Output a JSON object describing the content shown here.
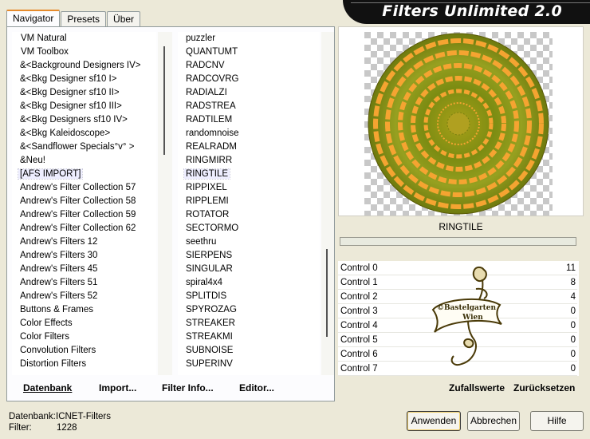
{
  "banner": {
    "title": "Filters Unlimited 2.0"
  },
  "tabs": [
    {
      "label": "Navigator",
      "active": true
    },
    {
      "label": "Presets",
      "active": false
    },
    {
      "label": "Über",
      "active": false
    }
  ],
  "categories": [
    "VM Natural",
    "VM Toolbox",
    "&<Background Designers IV>",
    "&<Bkg Designer sf10 I>",
    "&<Bkg Designer sf10 II>",
    "&<Bkg Designer sf10 III>",
    "&<Bkg Designers sf10 IV>",
    "&<Bkg Kaleidoscope>",
    "&<Sandflower Specials°v° >",
    "&Neu!",
    "[AFS IMPORT]",
    "Andrew's Filter Collection 57",
    "Andrew's Filter Collection 58",
    "Andrew's Filter Collection 59",
    "Andrew's Filter Collection 62",
    "Andrew's Filters 12",
    "Andrew's Filters 30",
    "Andrew's Filters 45",
    "Andrew's Filters 51",
    "Andrew's Filters 52",
    "Buttons & Frames",
    "Color Effects",
    "Color Filters",
    "Convolution Filters",
    "Distortion Filters"
  ],
  "selected_category": "[AFS IMPORT]",
  "filters": [
    "puzzler",
    "QUANTUMT",
    "RADCNV",
    "RADCOVRG",
    "RADIALZI",
    "RADSTREA",
    "RADTILEM",
    "randomnoise",
    "REALRADM",
    "RINGMIRR",
    "RINGTILE",
    "RIPPIXEL",
    "RIPPLEMI",
    "ROTATOR",
    "SECTORMO",
    "seethru",
    "SIERPENS",
    "SINGULAR",
    "spiral4x4",
    "SPLITDIS",
    "SPYROZAG",
    "STREAKER",
    "STREAKMI",
    "SUBNOISE",
    "SUPERINV"
  ],
  "selected_filter": "RINGTILE",
  "left_buttons": {
    "database": "Datenbank",
    "import": "Import...",
    "filter_info": "Filter Info...",
    "editor": "Editor..."
  },
  "preview": {
    "filter_name": "RINGTILE",
    "progress": 0
  },
  "controls": [
    {
      "label": "Control 0",
      "value": "11"
    },
    {
      "label": "Control 1",
      "value": "8"
    },
    {
      "label": "Control 2",
      "value": "4"
    },
    {
      "label": "Control 3",
      "value": "0"
    },
    {
      "label": "Control 4",
      "value": "0"
    },
    {
      "label": "Control 5",
      "value": "0"
    },
    {
      "label": "Control 6",
      "value": "0"
    },
    {
      "label": "Control 7",
      "value": "0"
    }
  ],
  "watermark": {
    "line1": "©Bastelgarten",
    "line2": "Wien"
  },
  "right_buttons": {
    "random": "Zufallswerte",
    "reset": "Zurücksetzen"
  },
  "status": {
    "database_label": "Datenbank:",
    "database_value": "ICNET-Filters",
    "filter_label": "Filter:",
    "filter_value": "1228"
  },
  "dialog_buttons": {
    "apply": "Anwenden",
    "cancel": "Abbrechen",
    "help": "Hilfe"
  },
  "colors": {
    "accent_tab": "#e68b2c",
    "ring_orange": "#f0a030",
    "ring_green": "#7a8a10",
    "watermark": "#4a3a08"
  }
}
